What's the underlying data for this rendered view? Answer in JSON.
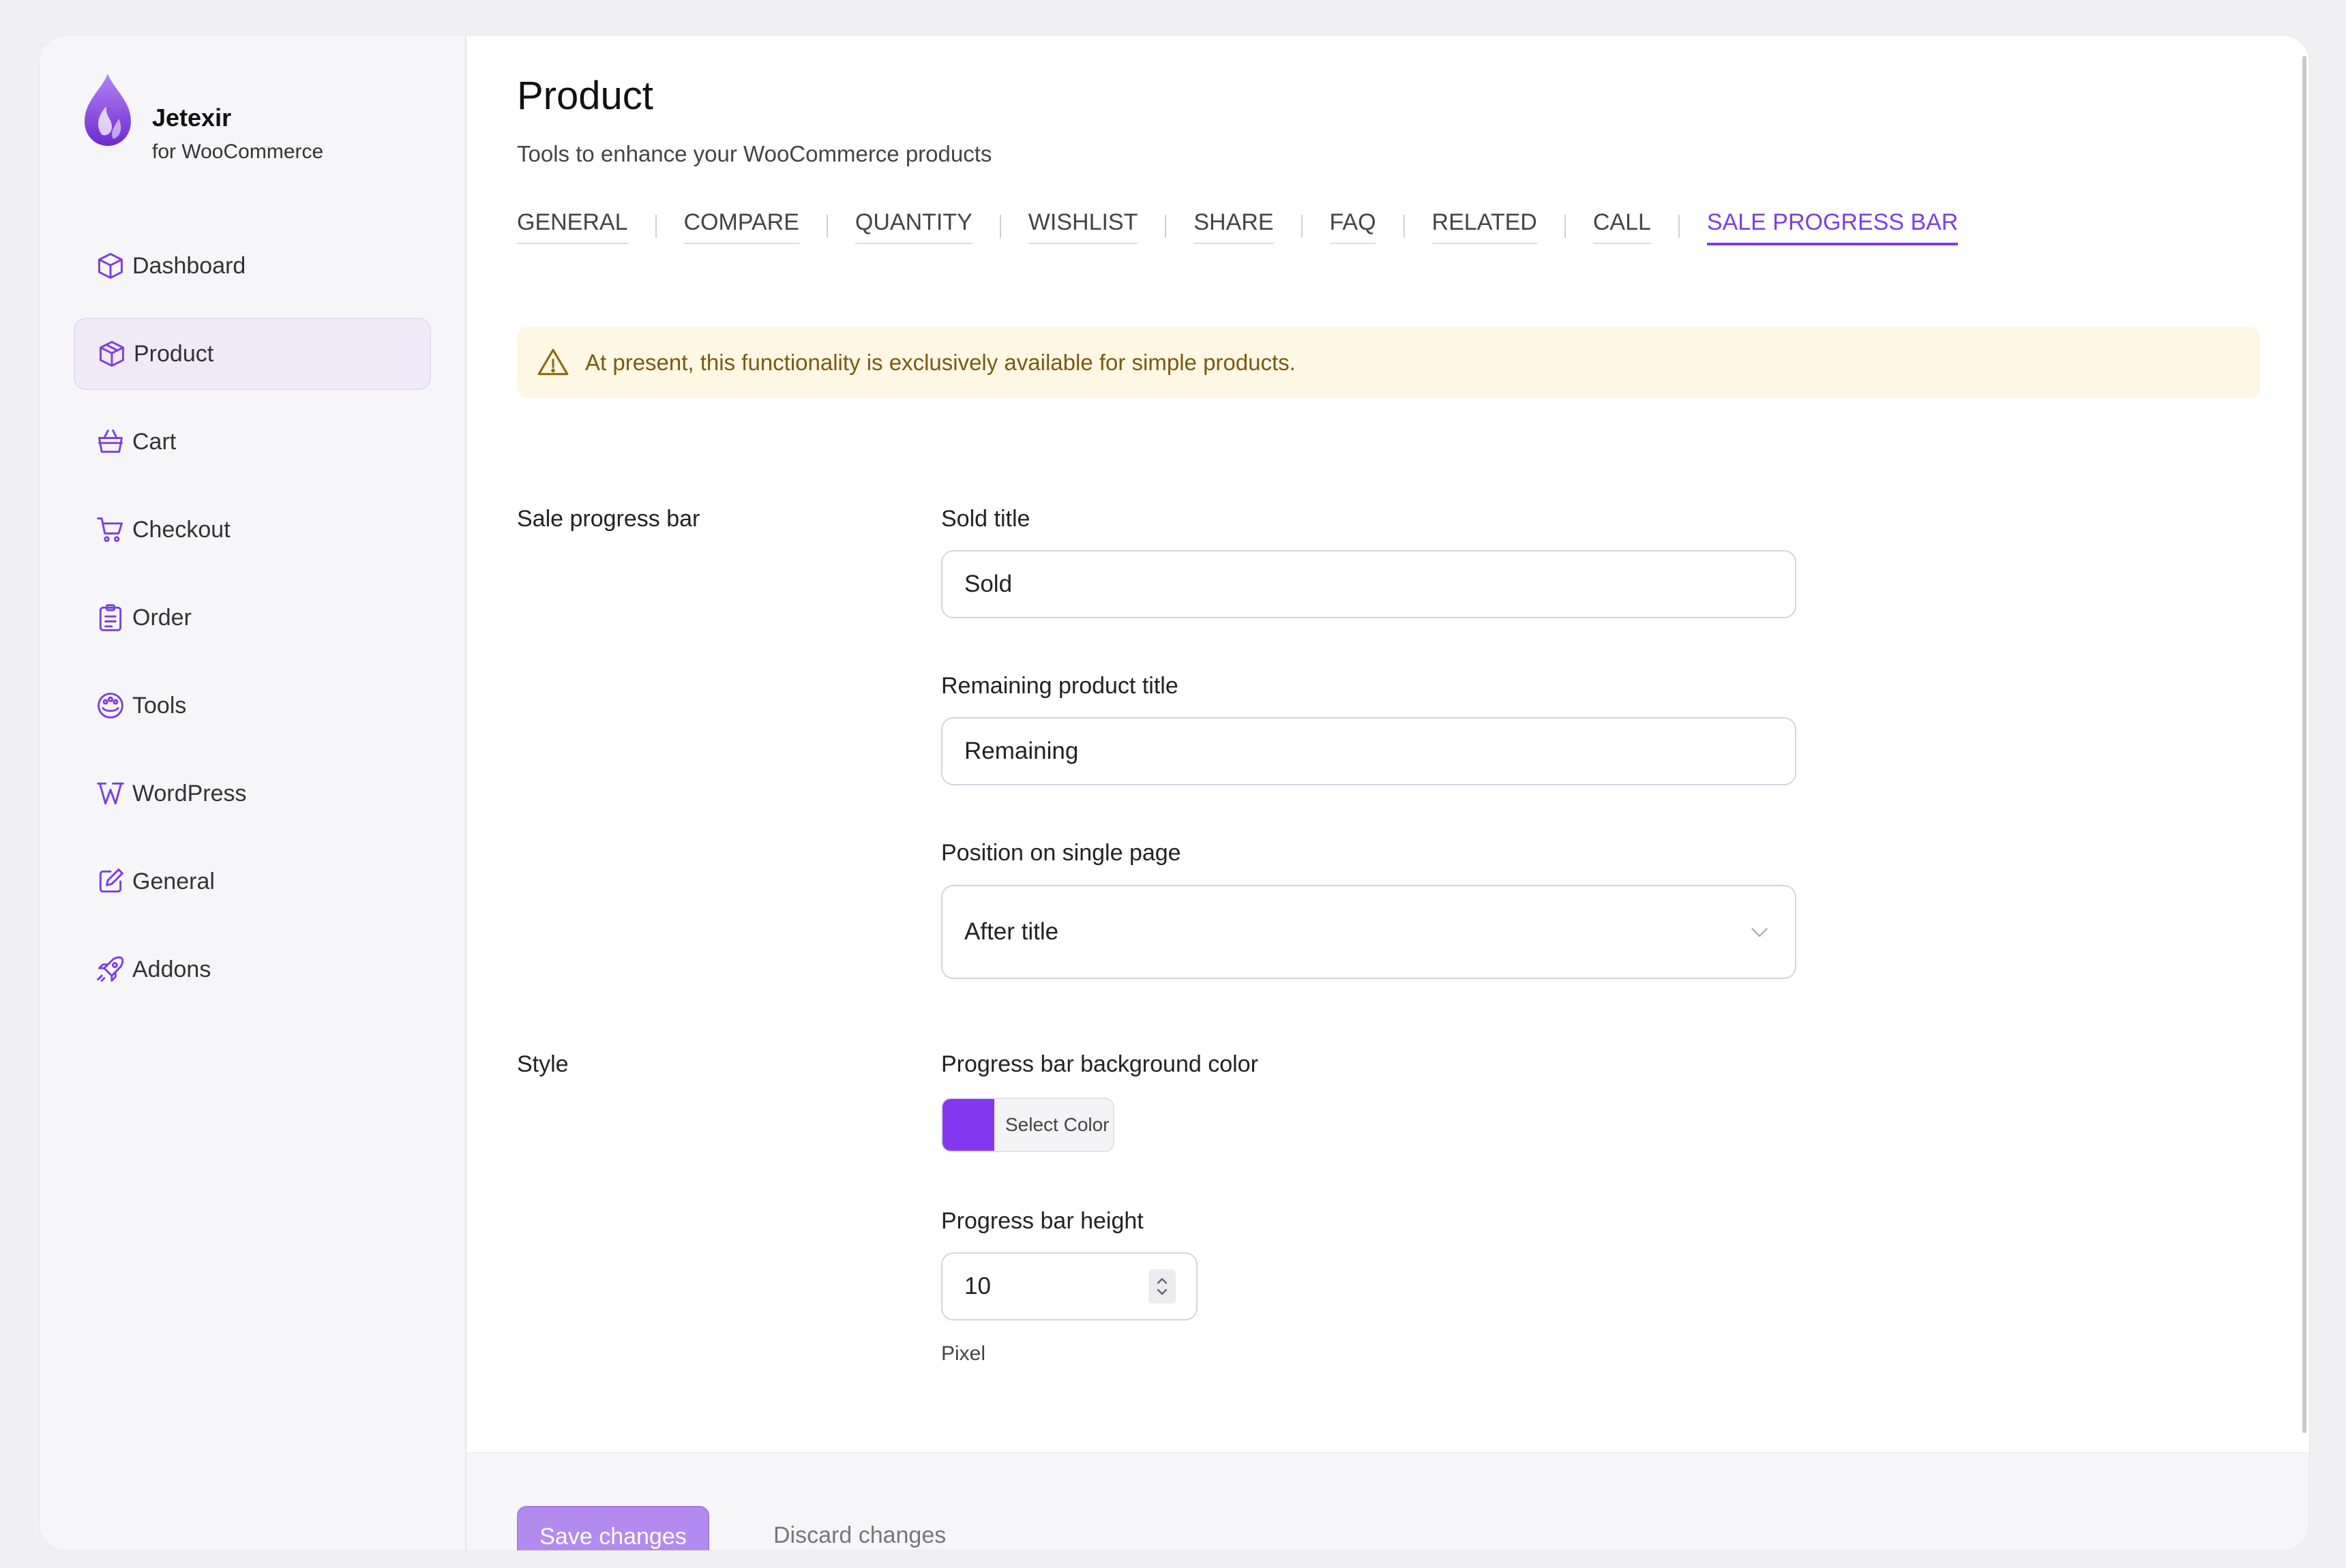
{
  "brand": {
    "name": "Jetexir",
    "subtitle": "for WooCommerce"
  },
  "colors": {
    "accent": "#7e3ee0",
    "active_nav_bg": "#eeeaf8",
    "notice_bg": "#fdf7e3",
    "progress_swatch": "#8338f0",
    "save_button": "#b38af0"
  },
  "sidebar": {
    "items": [
      {
        "label": "Dashboard",
        "icon": "box-icon",
        "active": false
      },
      {
        "label": "Product",
        "icon": "box-icon",
        "active": true
      },
      {
        "label": "Cart",
        "icon": "basket-icon",
        "active": false
      },
      {
        "label": "Checkout",
        "icon": "cart-icon",
        "active": false
      },
      {
        "label": "Order",
        "icon": "clipboard-icon",
        "active": false
      },
      {
        "label": "Tools",
        "icon": "palette-icon",
        "active": false
      },
      {
        "label": "WordPress",
        "icon": "wordpress-icon",
        "active": false
      },
      {
        "label": "General",
        "icon": "edit-icon",
        "active": false
      },
      {
        "label": "Addons",
        "icon": "rocket-icon",
        "active": false
      }
    ]
  },
  "header": {
    "title": "Product",
    "subtitle": "Tools to enhance your WooCommerce products"
  },
  "tabs": [
    "GENERAL",
    "COMPARE",
    "QUANTITY",
    "WISHLIST",
    "SHARE",
    "FAQ",
    "RELATED",
    "CALL",
    "SALE PROGRESS BAR"
  ],
  "active_tab": "SALE PROGRESS BAR",
  "notice": {
    "text": "At present, this functionality is exclusively available for simple products."
  },
  "sections": {
    "sale_progress_bar": {
      "label": "Sale progress bar",
      "sold_title": {
        "label": "Sold title",
        "value": "Sold"
      },
      "remaining_title": {
        "label": "Remaining product title",
        "value": "Remaining"
      },
      "position": {
        "label": "Position on single page",
        "value": "After title"
      }
    },
    "style": {
      "label": "Style",
      "bg_color": {
        "label": "Progress bar background color",
        "button": "Select Color",
        "value": "#8338f0"
      },
      "height": {
        "label": "Progress bar height",
        "value": "10",
        "unit": "Pixel"
      }
    }
  },
  "footer": {
    "save": "Save changes",
    "discard": "Discard changes"
  }
}
